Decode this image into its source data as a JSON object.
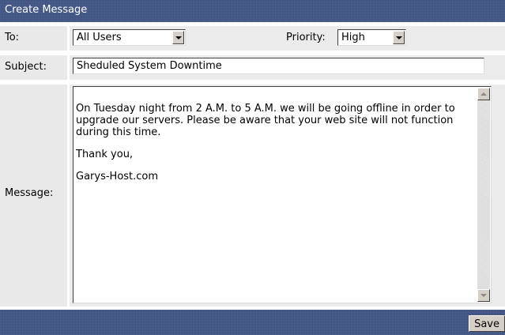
{
  "title": "Create Message",
  "to": {
    "label": "To:",
    "value": "All Users"
  },
  "priority": {
    "label": "Priority:",
    "value": "High"
  },
  "subject": {
    "label": "Subject:",
    "value": "Sheduled System Downtime"
  },
  "message": {
    "label": "Message:",
    "paragraphs": [
      "On Tuesday night from 2 A.M. to 5 A.M. we will be going offline in order to upgrade our servers.  Please be aware that your web site will not function during this time.",
      "Thank you,",
      "Garys-Host.com"
    ]
  },
  "footer": {
    "save_label": "Save"
  },
  "colors": {
    "header_bg": "#3b4f80",
    "label_bg": "#e9e9e9",
    "field_bg": "#ebebeb"
  },
  "icons": {
    "dropdown": "chevron-down-icon",
    "scroll_up": "scroll-up-icon",
    "scroll_down": "scroll-down-icon"
  }
}
